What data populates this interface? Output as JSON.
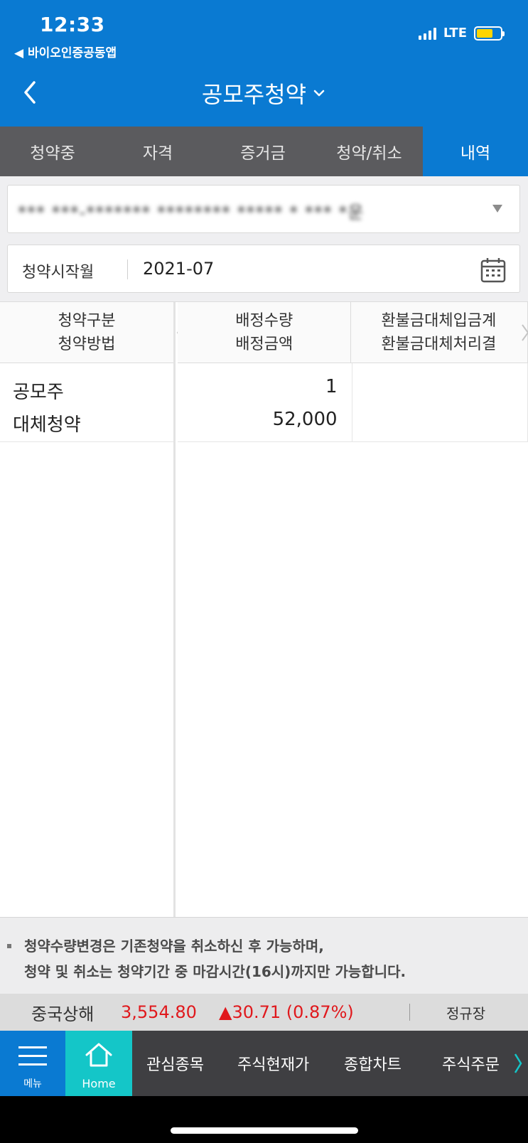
{
  "status_bar": {
    "time": "12:33",
    "back_app": "◀ 바이오인증공동앱",
    "network": "LTE",
    "battery_color": "#ffd500"
  },
  "header": {
    "title": "공모주청약",
    "back_icon": "chevron-left-icon",
    "title_dropdown_icon": "chevron-down-icon",
    "bg_color": "#0a7ad2"
  },
  "tabs": [
    {
      "label": "청약중",
      "active": false
    },
    {
      "label": "자격",
      "active": false
    },
    {
      "label": "증거금",
      "active": false
    },
    {
      "label": "청약/취소",
      "active": false
    },
    {
      "label": "내역",
      "active": true
    }
  ],
  "account": {
    "value": "*** ***-******* ******** ***** * *** *운"
  },
  "date_filter": {
    "label": "청약시작월",
    "value": "2021-07"
  },
  "table": {
    "left_header": [
      "청약구분",
      "청약방법"
    ],
    "columns": [
      {
        "line1": "배정수량",
        "line2": "배정금액"
      },
      {
        "line1": "환불금대체입금계",
        "line2": "환불금대체처리결"
      }
    ],
    "rows": [
      {
        "type1": "공모주",
        "type2": "대체청약",
        "qty": "1",
        "amount": "52,000",
        "refund1": "",
        "refund2": ""
      }
    ]
  },
  "notice": {
    "line1": "청약수량변경은 기존청약을 취소하신 후 가능하며,",
    "line2": "청약 및 취소는 청약기간 중 마감시간(16시)까지만 가능합니다."
  },
  "ticker": {
    "name": "중국상해",
    "price": "3,554.80",
    "change": "▲30.71 (0.87%)",
    "session": "정규장",
    "up_color": "#e0181c"
  },
  "bottom_nav": {
    "menu_label": "메뉴",
    "home_label": "Home",
    "items": [
      "관심종목",
      "주식현재가",
      "종합차트",
      "주식주문"
    ]
  }
}
